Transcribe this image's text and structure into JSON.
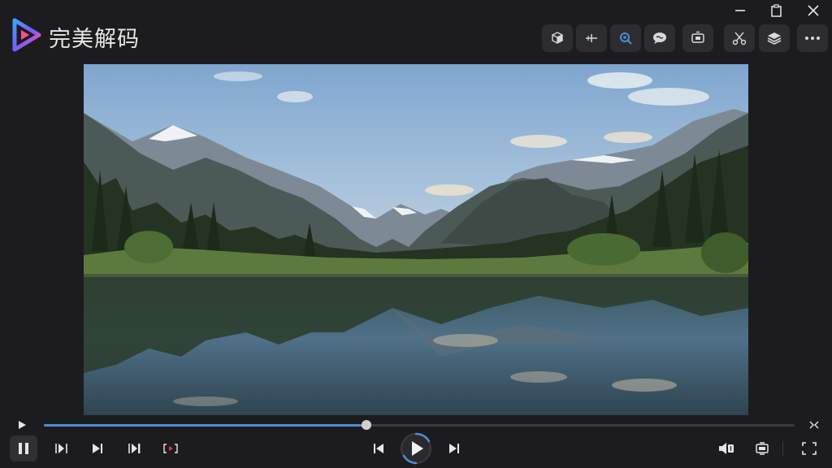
{
  "app": {
    "title": "完美解码",
    "accent": "#4b8fd6"
  },
  "window_controls": [
    "minimize-icon",
    "restore-icon",
    "close-icon"
  ],
  "toolbar": {
    "buttons": [
      "3d-cube-icon",
      "frame-step-icon",
      "search-zoom-icon",
      "chat-bubble-icon",
      "screen-cast-icon",
      "cut-clip-icon",
      "layers-icon",
      "more-options-icon"
    ]
  },
  "video": {
    "scene": "mountain-lake-landscape"
  },
  "playback": {
    "progress": 0.43,
    "state": "playing"
  },
  "controls": {
    "left": [
      "pause-icon",
      "step-back-frame-icon",
      "next-icon",
      "step-forward-frame-icon",
      "ab-loop-icon"
    ],
    "center": [
      "previous-track-icon",
      "play-icon",
      "next-track-icon"
    ],
    "right": [
      "audio-track-icon",
      "screen-mode-icon",
      "fullscreen-icon"
    ]
  }
}
